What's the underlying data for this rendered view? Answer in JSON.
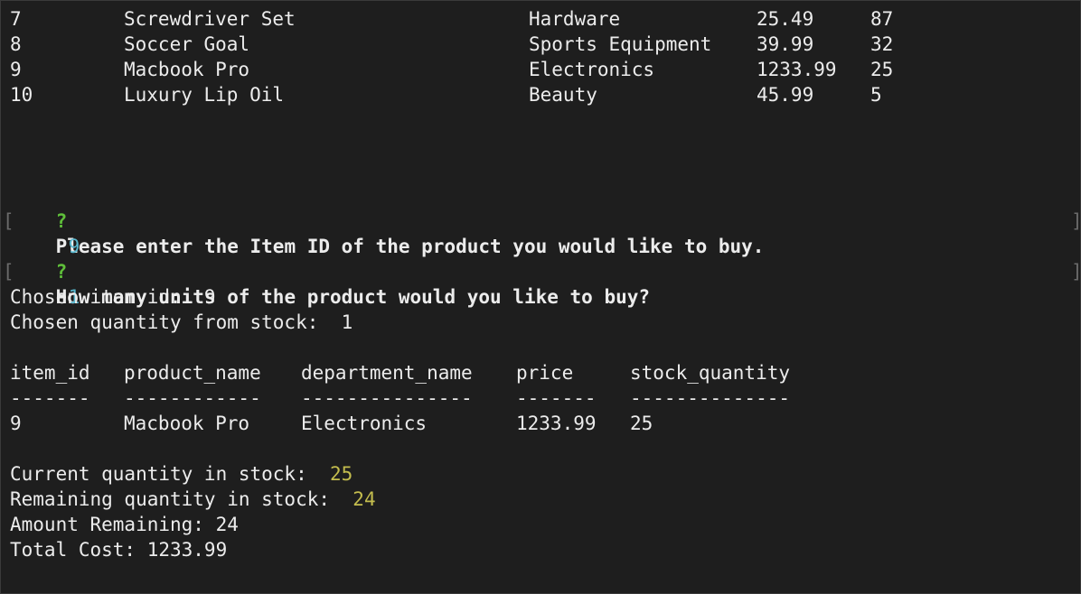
{
  "product_rows": [
    {
      "item_id": "7",
      "product_name": "Screwdriver Set",
      "department_name": "Hardware",
      "price": "25.49",
      "stock_quantity": "87"
    },
    {
      "item_id": "8",
      "product_name": "Soccer Goal",
      "department_name": "Sports Equipment",
      "price": "39.99",
      "stock_quantity": "32"
    },
    {
      "item_id": "9",
      "product_name": "Macbook Pro",
      "department_name": "Electronics",
      "price": "1233.99",
      "stock_quantity": "25"
    },
    {
      "item_id": "10",
      "product_name": "Luxury Lip Oil",
      "department_name": "Beauty",
      "price": "45.99",
      "stock_quantity": "5"
    }
  ],
  "prompts": {
    "mark": "?",
    "item_question": "Please enter the Item ID of the product you would like to buy.",
    "item_answer": "9",
    "quantity_question": "How many units of the product would you like to buy?",
    "quantity_answer": "1",
    "bracket_open": "[",
    "bracket_close": "]"
  },
  "chosen": {
    "item_id_line": "Chosen item id:  9",
    "quantity_line": "Chosen quantity from stock:  1"
  },
  "result_table": {
    "headers": [
      "item_id",
      "product_name",
      "department_name",
      "price",
      "stock_quantity"
    ],
    "separators": [
      "-------",
      "------------",
      "---------------",
      "-------",
      "--------------"
    ],
    "row": [
      "9",
      "Macbook Pro",
      "Electronics",
      "1233.99",
      "25"
    ]
  },
  "summary": {
    "current_label": "Current quantity in stock:  ",
    "current_value": "25",
    "remaining_label": "Remaining quantity in stock:  ",
    "remaining_value": "24",
    "amount_remaining": "Amount Remaining: 24",
    "total_cost": "Total Cost: 1233.99"
  },
  "colors": {
    "background": "#1e1e1e",
    "text": "#ececec",
    "prompt_mark": "#5fbf3a",
    "input_value": "#59b8cf",
    "highlight_value": "#c4bd4e"
  }
}
